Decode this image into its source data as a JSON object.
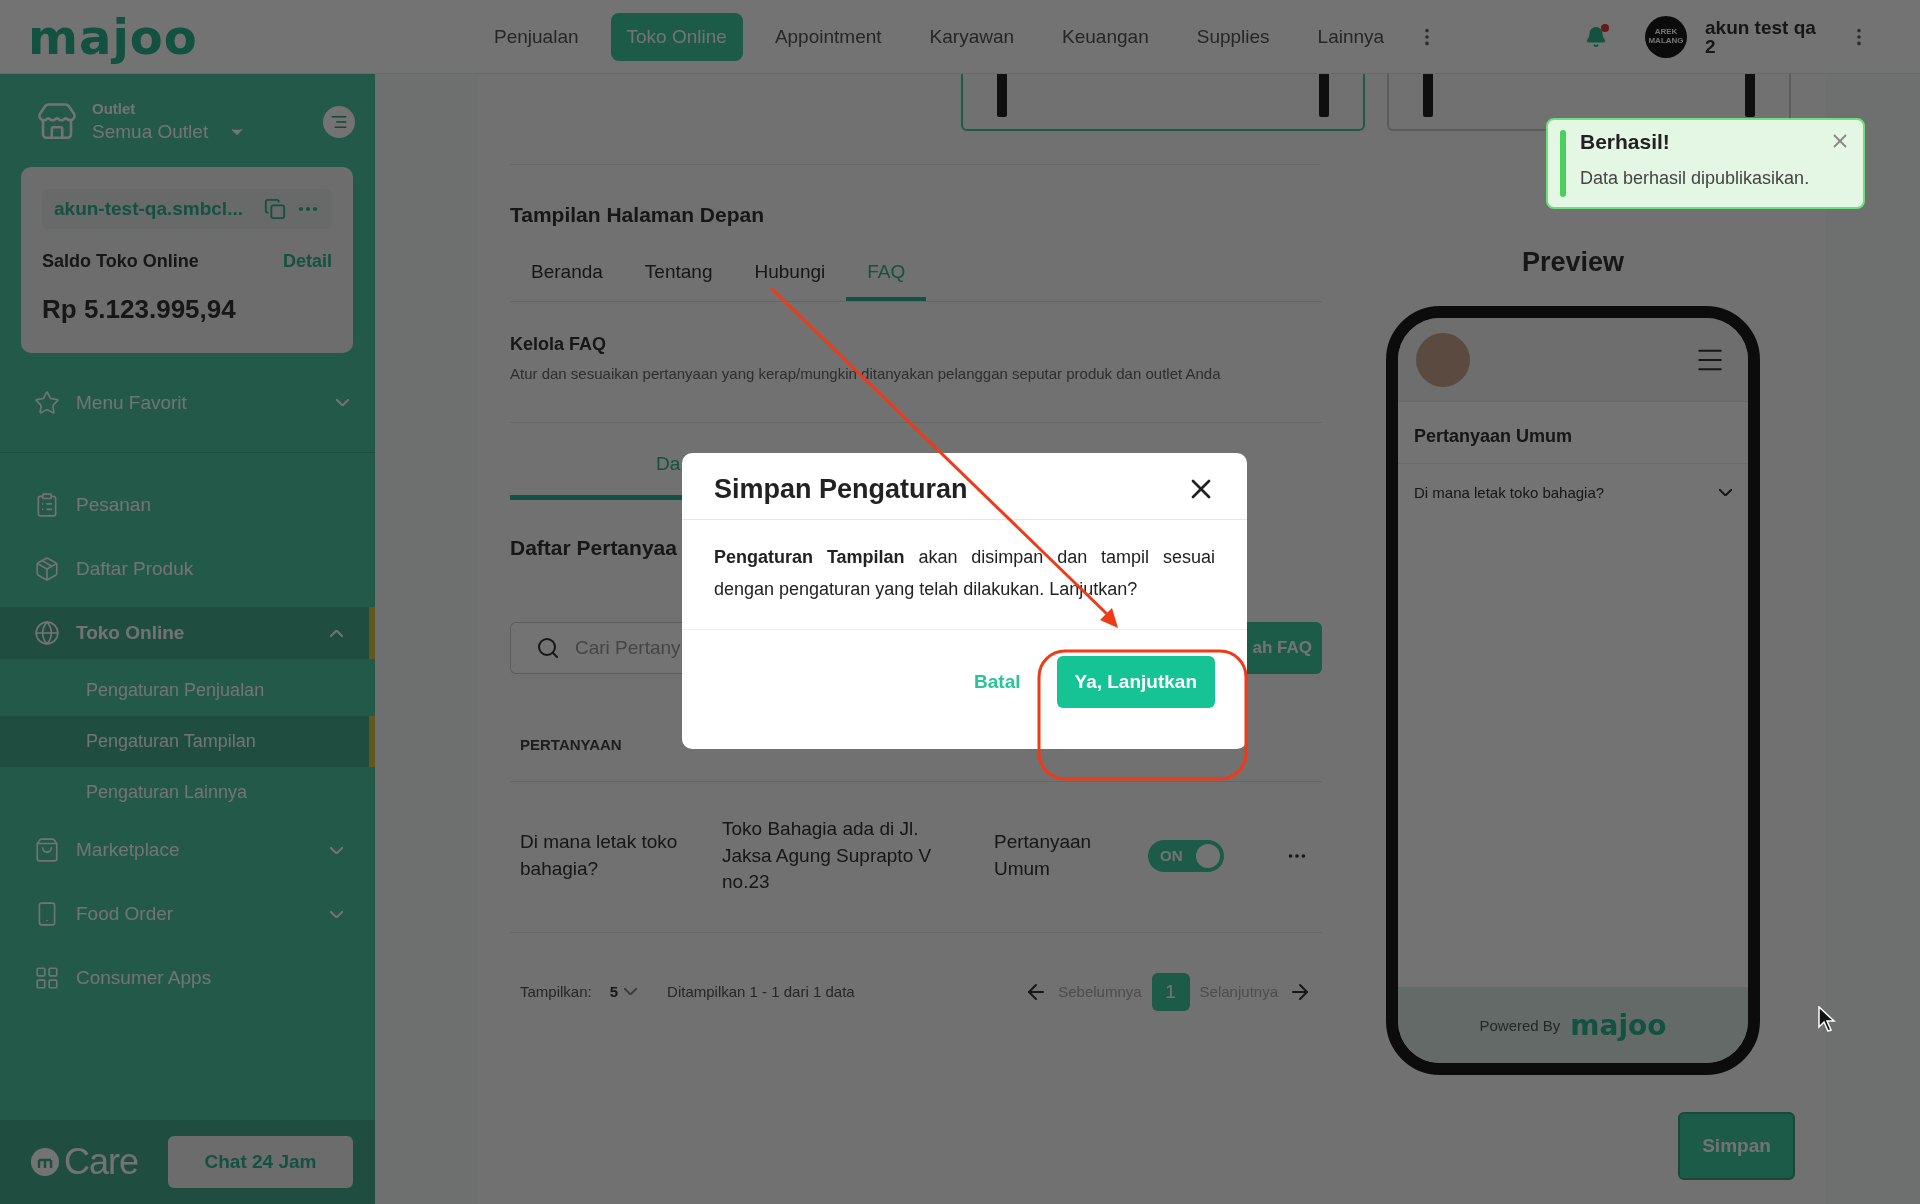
{
  "brand": {
    "logo": "majoo"
  },
  "nav": [
    {
      "label": "Penjualan",
      "selected": false
    },
    {
      "label": "Toko Online",
      "selected": true
    },
    {
      "label": "Appointment",
      "selected": false
    },
    {
      "label": "Karyawan",
      "selected": false
    },
    {
      "label": "Keuangan",
      "selected": false
    },
    {
      "label": "Supplies",
      "selected": false
    },
    {
      "label": "Lainnya",
      "selected": false
    }
  ],
  "notifications": {
    "unread": true
  },
  "user": {
    "avatar_text": "AREK MALANG",
    "name": "akun test qa 2"
  },
  "sidebar": {
    "outlet_label": "Outlet",
    "outlet_value": "Semua Outlet",
    "store": {
      "domain": "akun-test-qa.smbcl...",
      "balance_label": "Saldo Toko Online",
      "detail_link": "Detail",
      "balance": "Rp 5.123.995,94"
    },
    "favorites": {
      "label": "Menu Favorit",
      "expanded": false
    },
    "items": [
      {
        "label": "Pesanan",
        "selected": false
      },
      {
        "label": "Daftar Produk",
        "selected": false
      },
      {
        "label": "Toko Online",
        "selected": true,
        "expanded": true,
        "children": [
          {
            "label": "Pengaturan Penjualan",
            "selected": false
          },
          {
            "label": "Pengaturan Tampilan",
            "selected": true
          },
          {
            "label": "Pengaturan Lainnya",
            "selected": false
          }
        ]
      },
      {
        "label": "Marketplace",
        "selected": false,
        "expanded": false
      },
      {
        "label": "Food Order",
        "selected": false,
        "expanded": false
      },
      {
        "label": "Consumer Apps",
        "selected": false
      }
    ],
    "care": {
      "brand": "Care",
      "chat_button": "Chat 24 Jam"
    }
  },
  "templates": [
    {
      "selected": true
    },
    {
      "selected": false
    }
  ],
  "section_title": "Tampilan Halaman Depan",
  "tabs": [
    {
      "label": "Beranda",
      "selected": false
    },
    {
      "label": "Tentang",
      "selected": false
    },
    {
      "label": "Hubungi",
      "selected": false
    },
    {
      "label": "FAQ",
      "selected": true
    }
  ],
  "faq": {
    "title": "Kelola FAQ",
    "description": "Atur dan sesuaikan pertanyaan yang kerap/mungkin ditanyakan pelanggan seputar produk dan outlet Anda",
    "subtabs": [
      {
        "label": "Da",
        "selected": true
      }
    ],
    "list_title": "Daftar Pertanyaa",
    "search_placeholder": "Cari Pertany",
    "add_button": "ah FAQ",
    "columns": [
      "PERTANYAAN"
    ],
    "rows": [
      {
        "question": "Di mana letak toko bahagia?",
        "answer": "Toko Bahagia ada di Jl. Jaksa Agung Suprapto V no.23",
        "category": "Pertanyaan Umum",
        "published": true,
        "toggle_label": "ON"
      }
    ],
    "pagination": {
      "show_label": "Tampilkan:",
      "page_size": "5",
      "summary": "Ditampilkan 1 - 1 dari 1 data",
      "prev": "Sebelumnya",
      "pages": [
        {
          "label": "1",
          "selected": true
        }
      ],
      "next": "Selanjutnya"
    }
  },
  "preview": {
    "title": "Preview",
    "category": "Pertanyaan Umum",
    "question": "Di mana letak toko bahagia?",
    "powered_by": "Powered By",
    "brand": "majoo"
  },
  "save_button": "Simpan",
  "toast": {
    "title": "Berhasil!",
    "message": "Data berhasil dipublikasikan."
  },
  "dialog": {
    "title": "Simpan Pengaturan",
    "message": "**Pengaturan Tampilan** akan disimpan dan tampil sesuai dengan pengaturan yang telah dilakukan. Lanjutkan?",
    "cancel": "Batal",
    "confirm": "Ya, Lanjutkan"
  }
}
